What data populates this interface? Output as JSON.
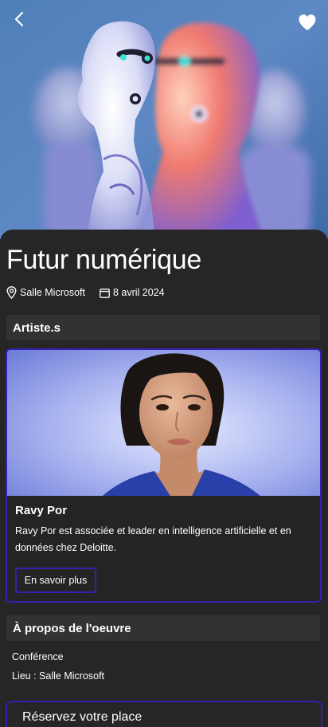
{
  "header": {
    "back_icon": "chevron-left-icon",
    "favorite_icon": "heart-icon"
  },
  "event": {
    "title": "Futur numérique",
    "location": "Salle Microsoft",
    "location_icon": "location-pin-icon",
    "date": "8 avril 2024",
    "date_icon": "calendar-icon"
  },
  "artists_section": {
    "title": "Artiste.s",
    "artists": [
      {
        "name": "Ravy Por",
        "bio": "Ravy Por est associée et leader en intelligence artificielle et en données chez Deloitte.",
        "button_label": "En savoir plus"
      }
    ]
  },
  "about_section": {
    "title": "À propos de l'oeuvre",
    "type": "Conférence",
    "venue": "Lieu : Salle Microsoft"
  },
  "reserve": {
    "label": "Réservez votre place"
  },
  "colors": {
    "background": "#1b1b1b",
    "sheet": "#262626",
    "section_header": "#323232",
    "accent_border": "#3a1eb0",
    "text": "#ffffff"
  }
}
